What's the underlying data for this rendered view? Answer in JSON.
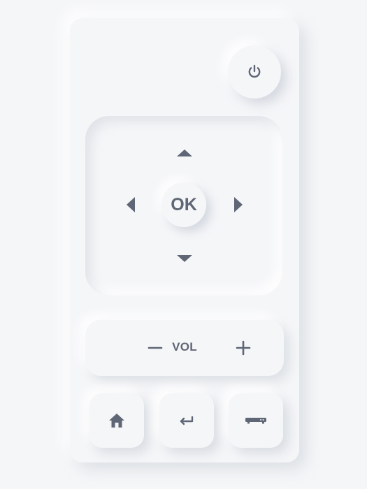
{
  "remote": {
    "buttons": {
      "power_icon": "power-icon",
      "ok_label": "OK",
      "vol_label": "VOL",
      "home_icon": "home-icon",
      "back_icon": "return-icon",
      "source_icon": "set-top-box-icon"
    }
  },
  "colors": {
    "background": "#f5f6f8",
    "icon": "#5f6675"
  }
}
